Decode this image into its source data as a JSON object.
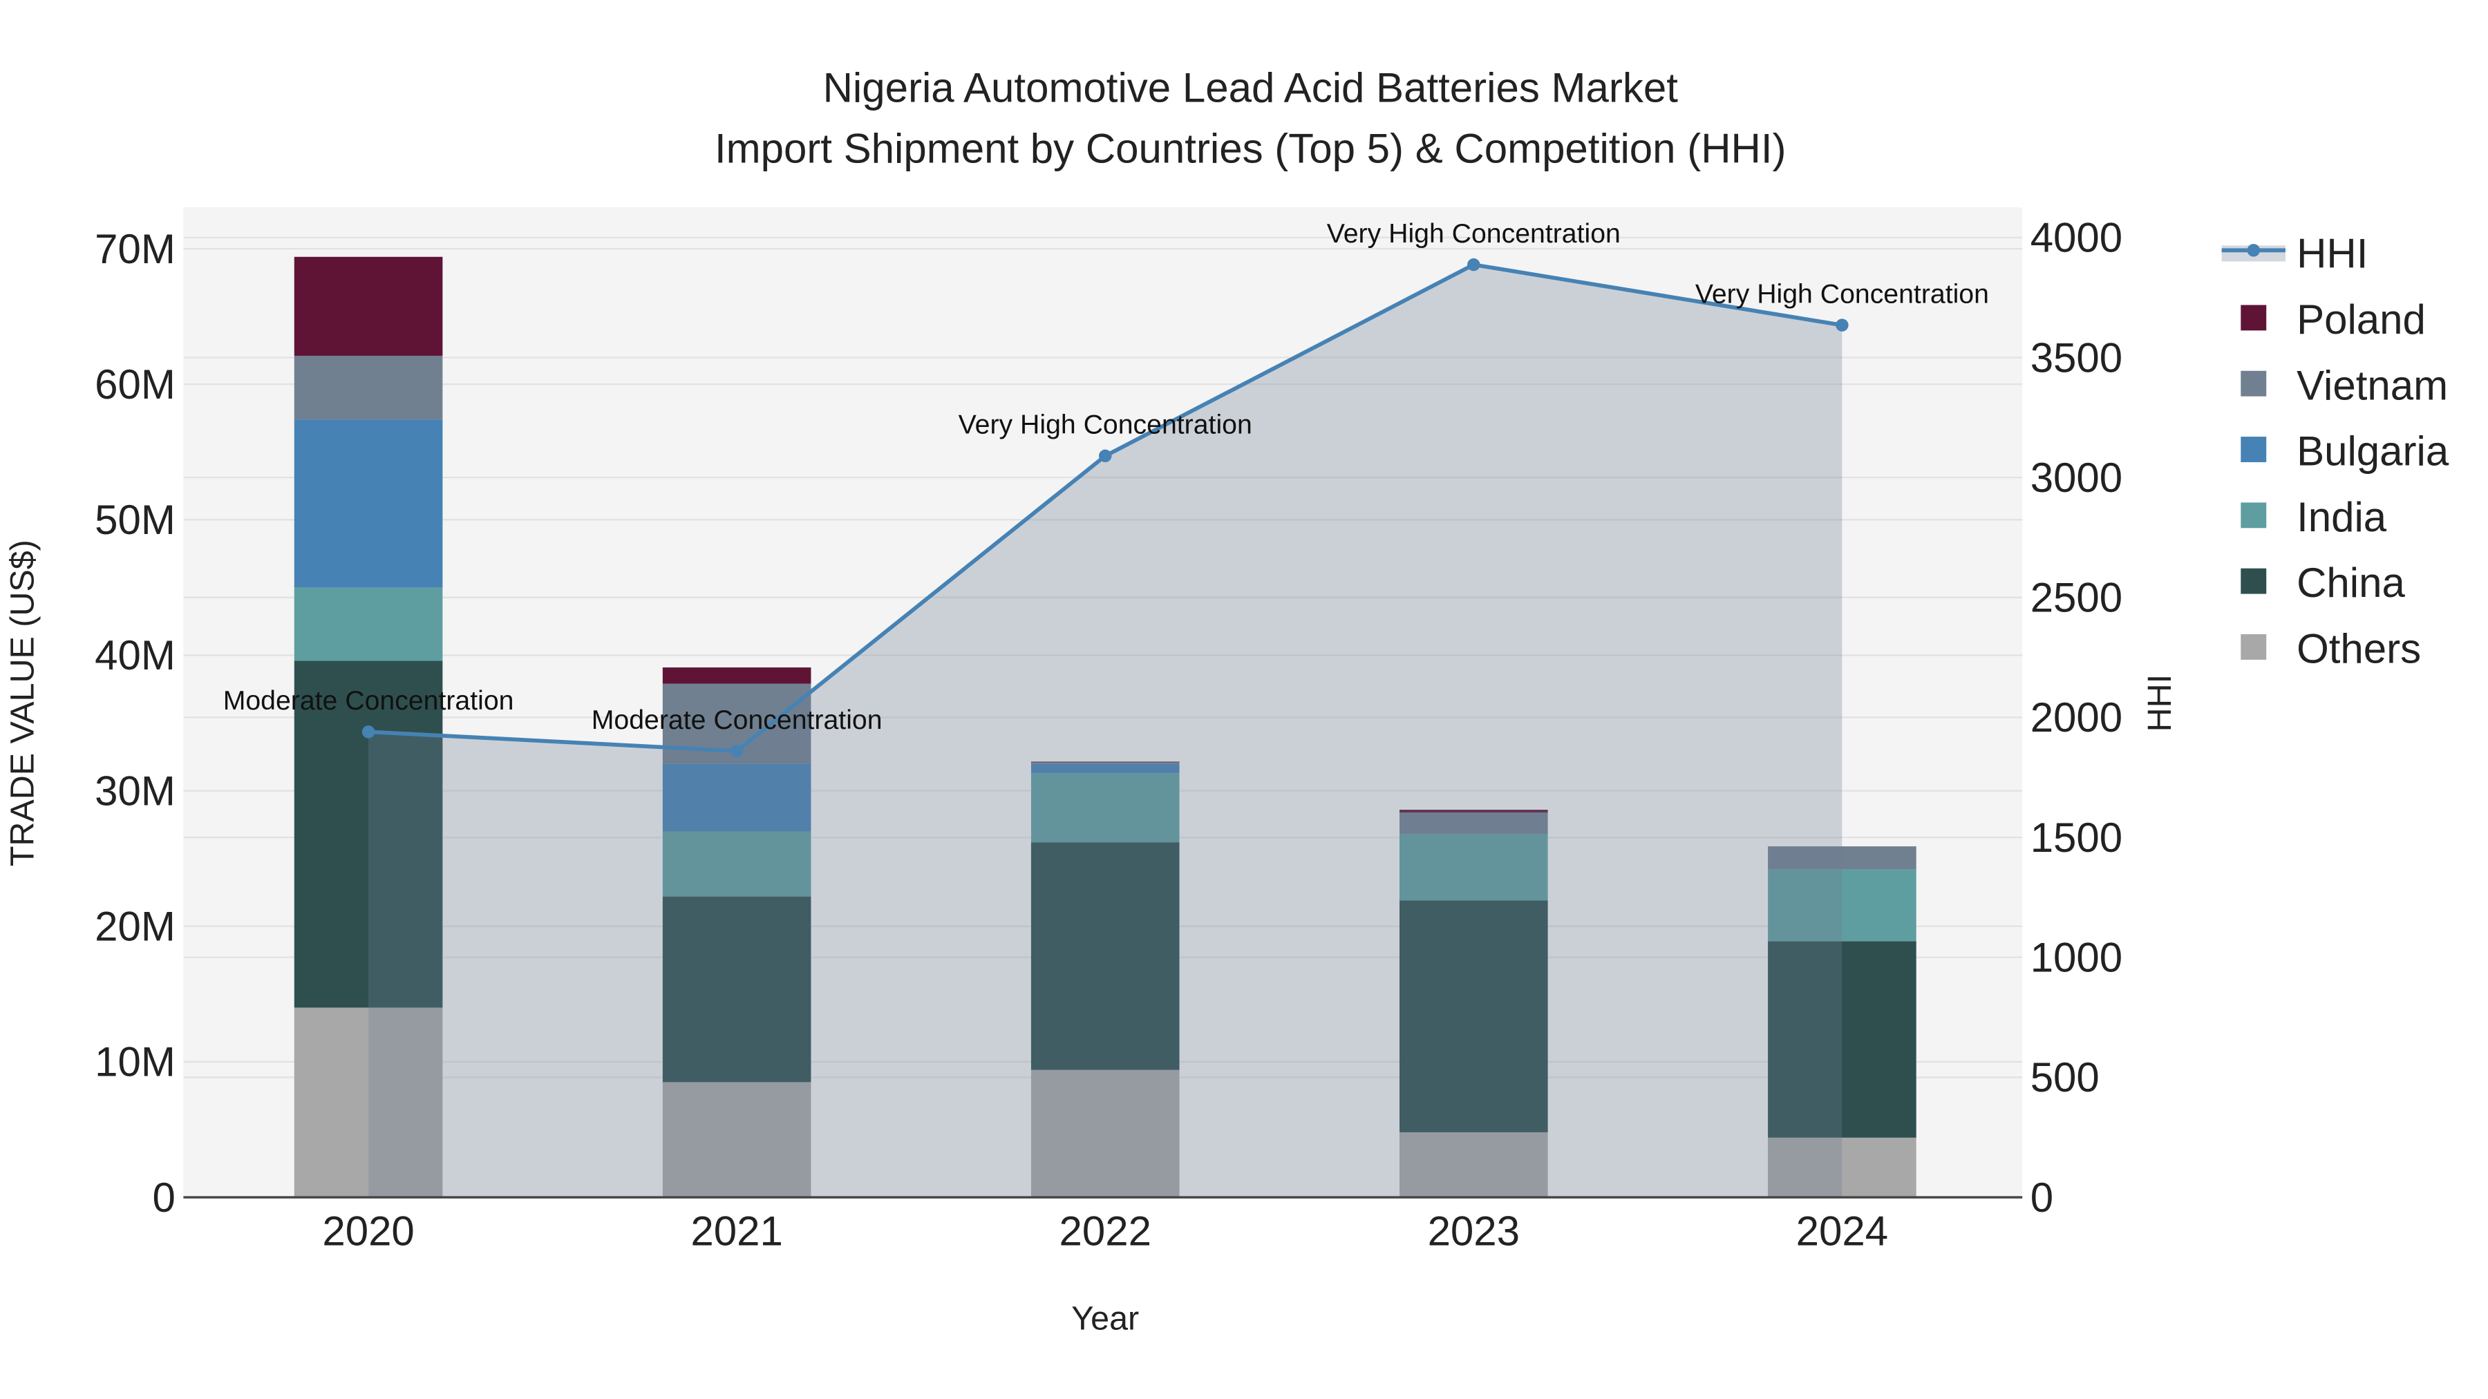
{
  "chart_data": {
    "type": "bar",
    "title": [
      "Nigeria Automotive Lead Acid Batteries Market",
      "Import Shipment by Countries (Top 5) & Competition (HHI)"
    ],
    "xlabel": "Year",
    "ylabel": "TRADE VALUE (US$)",
    "y2label": "HHI",
    "categories": [
      "2020",
      "2021",
      "2022",
      "2023",
      "2024"
    ],
    "ylim": [
      0,
      73000000
    ],
    "y2lim": [
      0,
      4130
    ],
    "yticks": [
      0,
      10000000,
      20000000,
      30000000,
      40000000,
      50000000,
      60000000,
      70000000
    ],
    "ytick_labels": [
      "0",
      "10M",
      "20M",
      "30M",
      "40M",
      "50M",
      "60M",
      "70M"
    ],
    "y2ticks": [
      0,
      500,
      1000,
      1500,
      2000,
      2500,
      3000,
      3500,
      4000
    ],
    "y2tick_labels": [
      "0",
      "500",
      "1000",
      "1500",
      "2000",
      "2500",
      "3000",
      "3500",
      "4000"
    ],
    "grid": true,
    "legend_position": "right",
    "series": [
      {
        "name": "Others",
        "color": "#a8a8a8",
        "values": [
          14000000,
          8500000,
          9400000,
          4800000,
          4400000
        ]
      },
      {
        "name": "China",
        "color": "#2f4f4f",
        "values": [
          25600000,
          13700000,
          16800000,
          17100000,
          14500000
        ]
      },
      {
        "name": "India",
        "color": "#5f9ea0",
        "values": [
          5400000,
          4800000,
          5100000,
          4900000,
          5300000
        ]
      },
      {
        "name": "Bulgaria",
        "color": "#4682b4",
        "values": [
          12400000,
          5000000,
          700000,
          0,
          0
        ]
      },
      {
        "name": "Vietnam",
        "color": "#708090",
        "values": [
          4700000,
          5900000,
          100000,
          1600000,
          1700000
        ]
      },
      {
        "name": "Poland",
        "color": "#5f1436",
        "values": [
          7300000,
          1200000,
          50000,
          200000,
          0
        ]
      }
    ],
    "line": {
      "name": "HHI",
      "color": "#4682b4",
      "values": [
        1940,
        1860,
        3090,
        3887,
        3635
      ],
      "annotations": [
        "Moderate Concentration",
        "Moderate Concentration",
        "Very High Concentration",
        "Very High Concentration",
        "Very High Concentration"
      ]
    },
    "legend_order": [
      "HHI",
      "Poland",
      "Vietnam",
      "Bulgaria",
      "India",
      "China",
      "Others"
    ]
  }
}
